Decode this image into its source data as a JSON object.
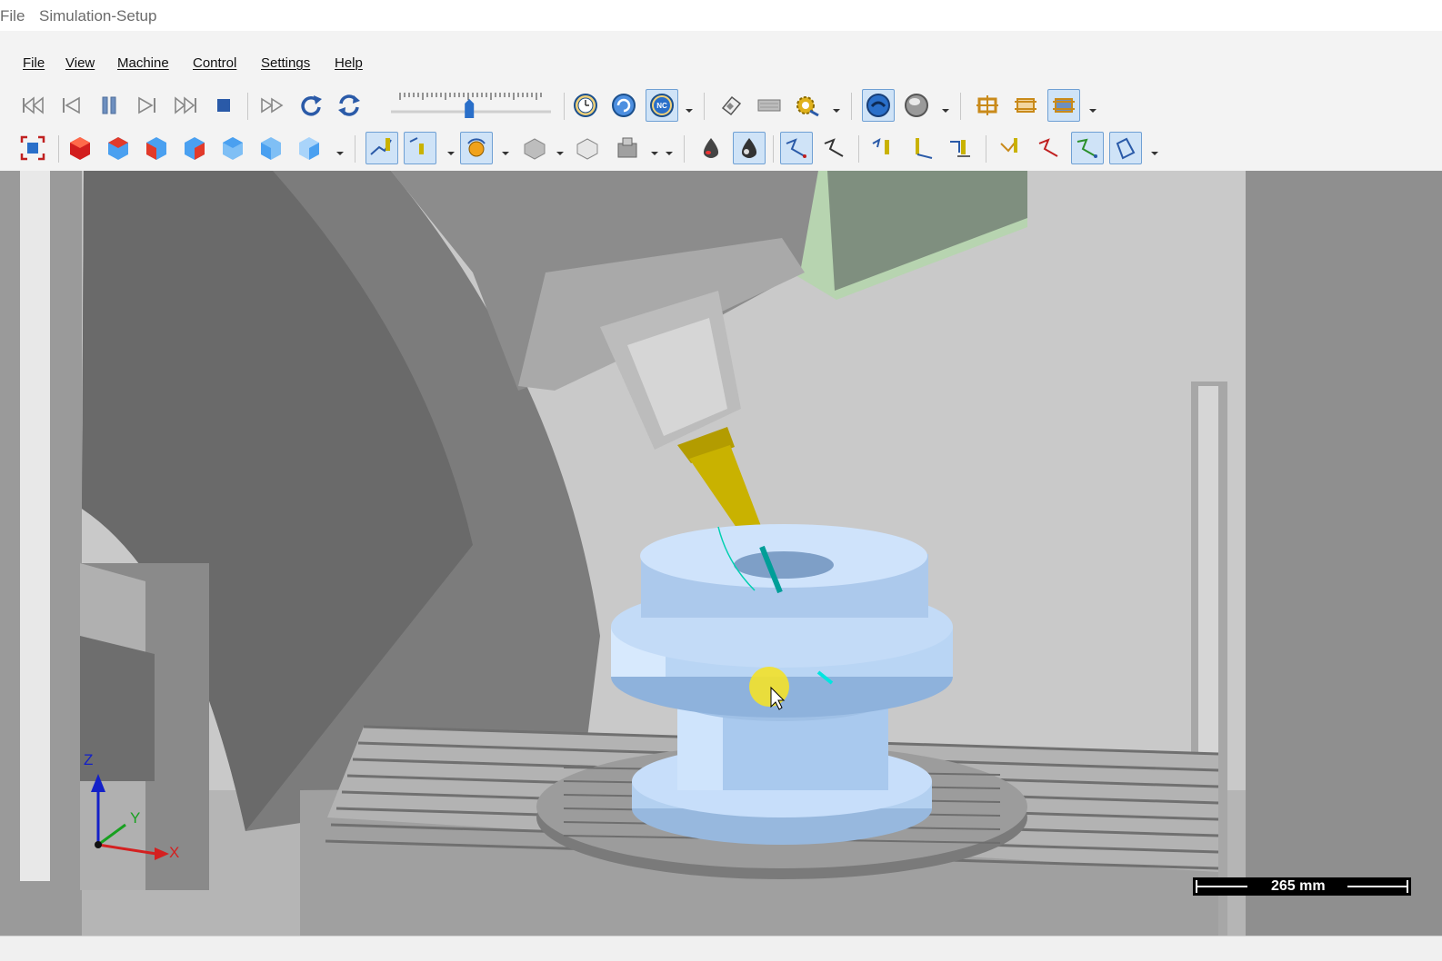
{
  "window": {
    "menu_label": "File",
    "title": "Simulation-Setup"
  },
  "menu": {
    "items": [
      "File",
      "View",
      "Machine",
      "Control",
      "Settings",
      "Help"
    ]
  },
  "playback": {
    "speed_fraction": 0.47
  },
  "viewport": {
    "scale_label": "265 mm",
    "axes": {
      "z": "Z",
      "y": "Y",
      "x": "X"
    }
  },
  "colors": {
    "workpiece": "#a9c9ee",
    "tool_holder": "#c9b200",
    "toolpath": "#00d0b0",
    "spindle_head": "#a6c9a0",
    "background": "#a7a7a7"
  },
  "icons": {
    "toolbar1": [
      "go-to-start-icon",
      "step-back-icon",
      "pause-icon",
      "step-forward-icon",
      "go-to-end-icon",
      "stop-icon",
      "fast-forward-icon",
      "rewind-loop-icon",
      "cycle-icon",
      "speed-slider",
      "clock-icon",
      "sync-icon",
      "nc-code-icon",
      "eraser-icon",
      "keyboard-icon",
      "gear-tool-icon",
      "machine-view-icon",
      "sphere-icon",
      "frame-icon",
      "fixture-icon",
      "setup-icon"
    ],
    "toolbar2": [
      "fit-view-icon",
      "cube-iso-icon",
      "cube-front-icon",
      "cube-back-icon",
      "cube-left-icon",
      "cube-right-icon",
      "cube-top-icon",
      "cube-bottom-icon",
      "tool-path-icon",
      "tool-icon",
      "rotate-icon",
      "stock-icon",
      "part-icon",
      "machine-icon",
      "drop-shade-icon",
      "drop-solid-icon",
      "path-a-icon",
      "path-b-icon",
      "tool-a-icon",
      "tool-b-icon",
      "tool-c-icon",
      "tool-d-icon",
      "path-c-icon",
      "path-d-icon",
      "path-e-icon"
    ]
  }
}
